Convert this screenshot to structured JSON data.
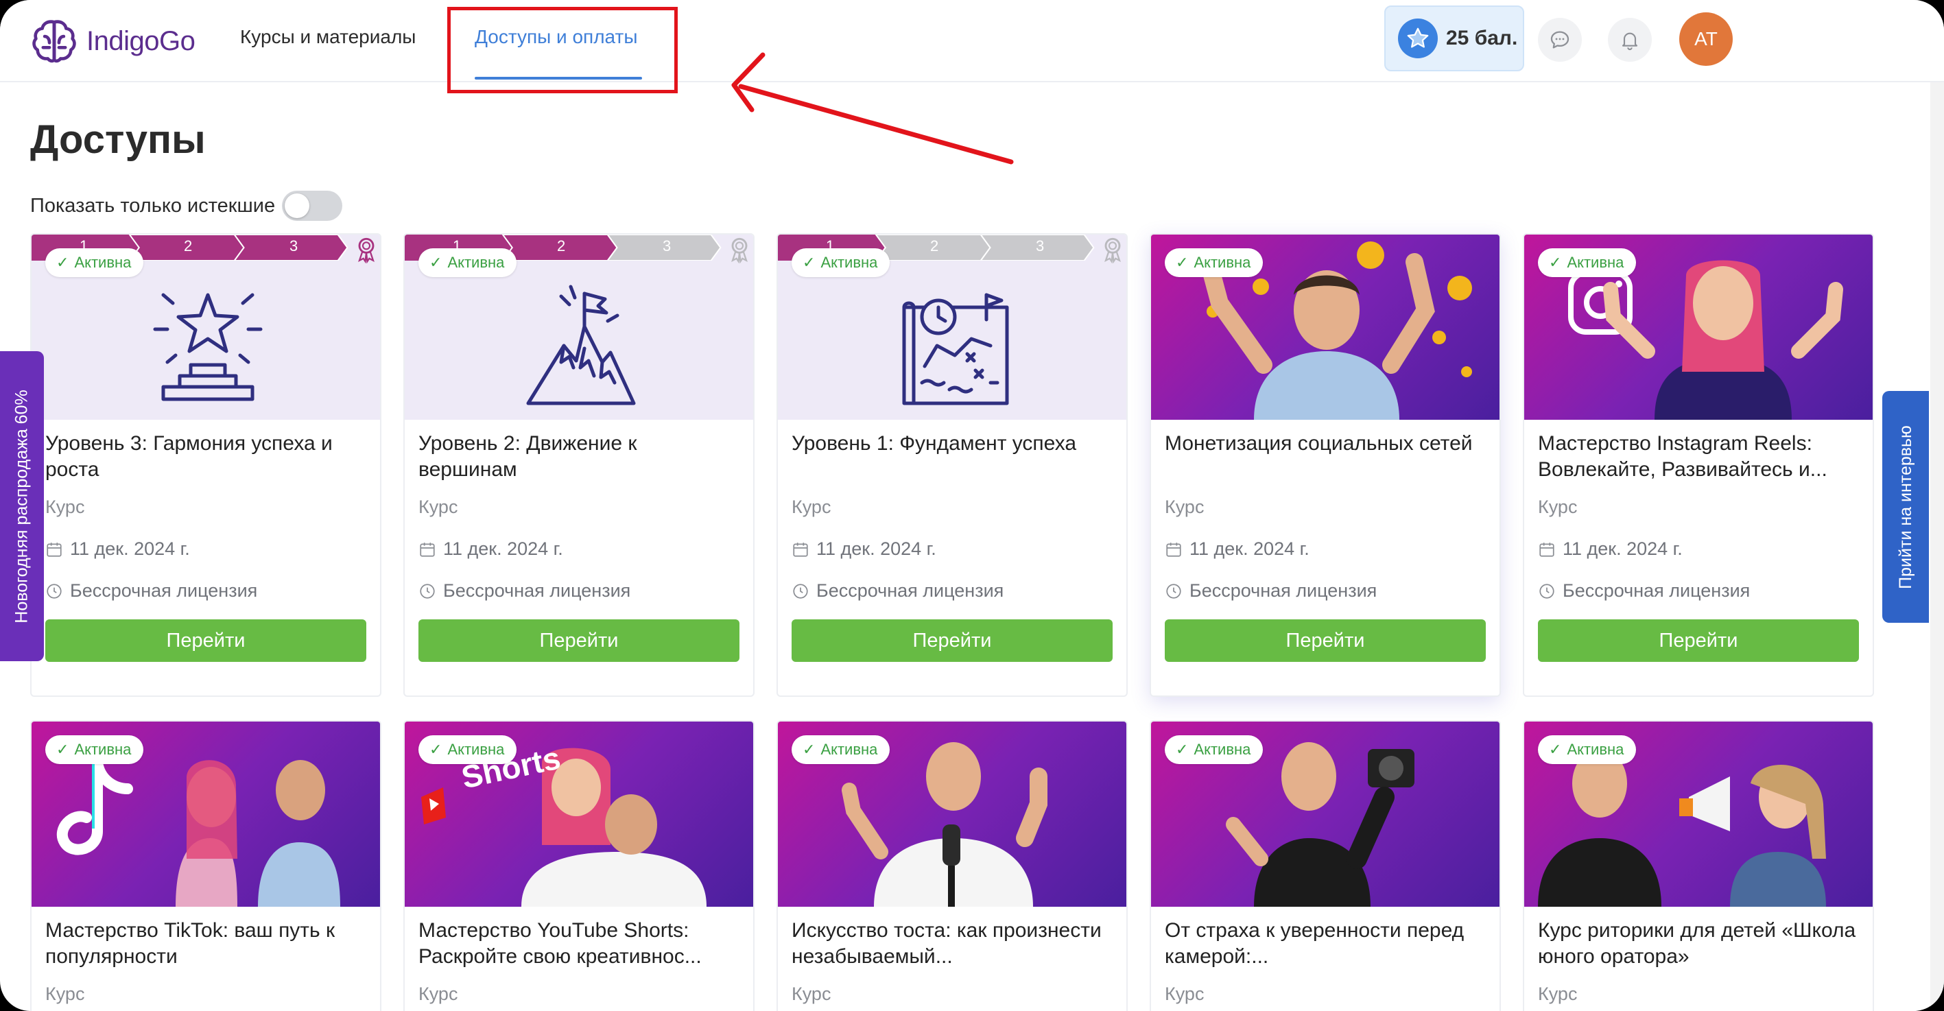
{
  "app": {
    "logo_text": "IndigoGo"
  },
  "nav": {
    "courses_label": "Курсы и материалы",
    "access_label": "Доступы и оплаты"
  },
  "header": {
    "points_label": "25 бал.",
    "avatar_initials": "AT"
  },
  "page": {
    "title": "Доступы",
    "filter_label": "Показать только истекшие",
    "filter_enabled": false
  },
  "side_tabs": {
    "sale_label": "Новогодняя распродажа 60%",
    "interview_label": "Прийти на интервью"
  },
  "colors": {
    "accent_blue": "#3f7fd8",
    "button_green": "#67bb44",
    "status_green": "#3aa042",
    "brand_purple": "#5b2d8e",
    "highlight_red": "#e2141b"
  },
  "cards": [
    {
      "status": "Активна",
      "title": "Уровень 3: Гармония успеха и роста",
      "type": "Курс",
      "date": "11 дек. 2024 г.",
      "license": "Бессрочная лицензия",
      "button": "Перейти",
      "levels": [
        "1",
        "2",
        "3"
      ],
      "levels_completed": 3
    },
    {
      "status": "Активна",
      "title": "Уровень 2: Движение к вершинам",
      "type": "Курс",
      "date": "11 дек. 2024 г.",
      "license": "Бессрочная лицензия",
      "button": "Перейти",
      "levels": [
        "1",
        "2",
        "3"
      ],
      "levels_completed": 2
    },
    {
      "status": "Активна",
      "title": "Уровень 1: Фундамент успеха",
      "type": "Курс",
      "date": "11 дек. 2024 г.",
      "license": "Бессрочная лицензия",
      "button": "Перейти",
      "levels": [
        "1",
        "2",
        "3"
      ],
      "levels_completed": 1
    },
    {
      "status": "Активна",
      "title": "Монетизация социальных сетей",
      "type": "Курс",
      "date": "11 дек. 2024 г.",
      "license": "Бессрочная лицензия",
      "button": "Перейти"
    },
    {
      "status": "Активна",
      "title": "Мастерство Instagram Reels: Вовлекайте, Развивайтесь и...",
      "type": "Курс",
      "date": "11 дек. 2024 г.",
      "license": "Бессрочная лицензия",
      "button": "Перейти"
    },
    {
      "status": "Активна",
      "title": "Мастерство TikTok: ваш путь к популярности",
      "type": "Курс"
    },
    {
      "status": "Активна",
      "title": "Мастерство YouTube Shorts: Раскройте свою креативнос...",
      "type": "Курс",
      "image_text": "Shorts"
    },
    {
      "status": "Активна",
      "title": "Искусство тоста: как произнести незабываемый...",
      "type": "Курс"
    },
    {
      "status": "Активна",
      "title": "От страха к уверенности перед камерой:...",
      "type": "Курс"
    },
    {
      "status": "Активна",
      "title": "Курс риторики для детей «Школа юного оратора»",
      "type": "Курс"
    }
  ]
}
